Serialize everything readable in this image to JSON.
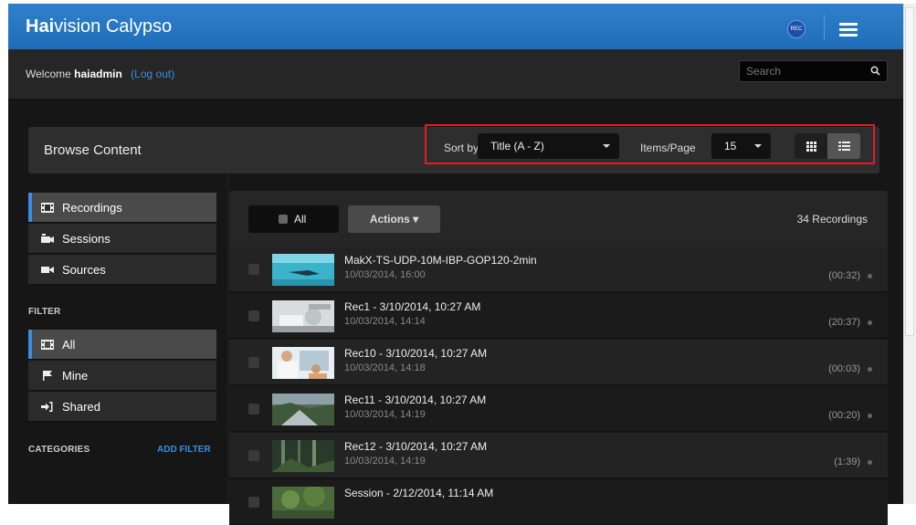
{
  "app": {
    "brand_bold": "Hai",
    "brand_rest": "vision Calypso",
    "rec_label": "REC"
  },
  "welcome": {
    "prefix": "Welcome",
    "user": "haiadmin",
    "logout": "(Log out)"
  },
  "search": {
    "placeholder": "Search",
    "value": ""
  },
  "browse": {
    "title": "Browse Content",
    "sort_label": "Sort by",
    "sort_value": "Title (A - Z)",
    "items_label": "Items/Page",
    "items_value": "15"
  },
  "sidebar": {
    "nav": [
      {
        "label": "Recordings",
        "icon": "film-icon",
        "active": true
      },
      {
        "label": "Sessions",
        "icon": "camera-icon",
        "active": false
      },
      {
        "label": "Sources",
        "icon": "video-camera-icon",
        "active": false
      }
    ],
    "filter_heading": "FILTER",
    "filters": [
      {
        "label": "All",
        "icon": "film-icon",
        "active": true
      },
      {
        "label": "Mine",
        "icon": "flag-icon",
        "active": false
      },
      {
        "label": "Shared",
        "icon": "share-icon",
        "active": false
      }
    ],
    "categories_heading": "CATEGORIES",
    "add_filter": "ADD FILTER"
  },
  "content": {
    "all_label": "All",
    "actions_label": "Actions ▾",
    "count_label": "34 Recordings",
    "rows": [
      {
        "title": "MakX-TS-UDP-10M-IBP-GOP120-2min",
        "date": "10/03/2014, 16:00",
        "duration": "(00:32)",
        "thumb": "ocean"
      },
      {
        "title": "Rec1 - 3/10/2014, 10:27 AM",
        "date": "10/03/2014, 14:14",
        "duration": "(20:37)",
        "thumb": "hospital"
      },
      {
        "title": "Rec10 - 3/10/2014, 10:27 AM",
        "date": "10/03/2014, 14:18",
        "duration": "(00:03)",
        "thumb": "doctor"
      },
      {
        "title": "Rec11 - 3/10/2014, 10:27 AM",
        "date": "10/03/2014, 14:19",
        "duration": "(00:20)",
        "thumb": "river"
      },
      {
        "title": "Rec12 - 3/10/2014, 10:27 AM",
        "date": "10/03/2014, 14:19",
        "duration": "(1:39)",
        "thumb": "forest"
      },
      {
        "title": "Session - 2/12/2014, 11:14 AM",
        "date": "",
        "duration": "",
        "thumb": "jungle"
      }
    ]
  },
  "colors": {
    "accent": "#3b8ee0",
    "header": "#2a7bc8",
    "highlight": "#e01c24"
  }
}
